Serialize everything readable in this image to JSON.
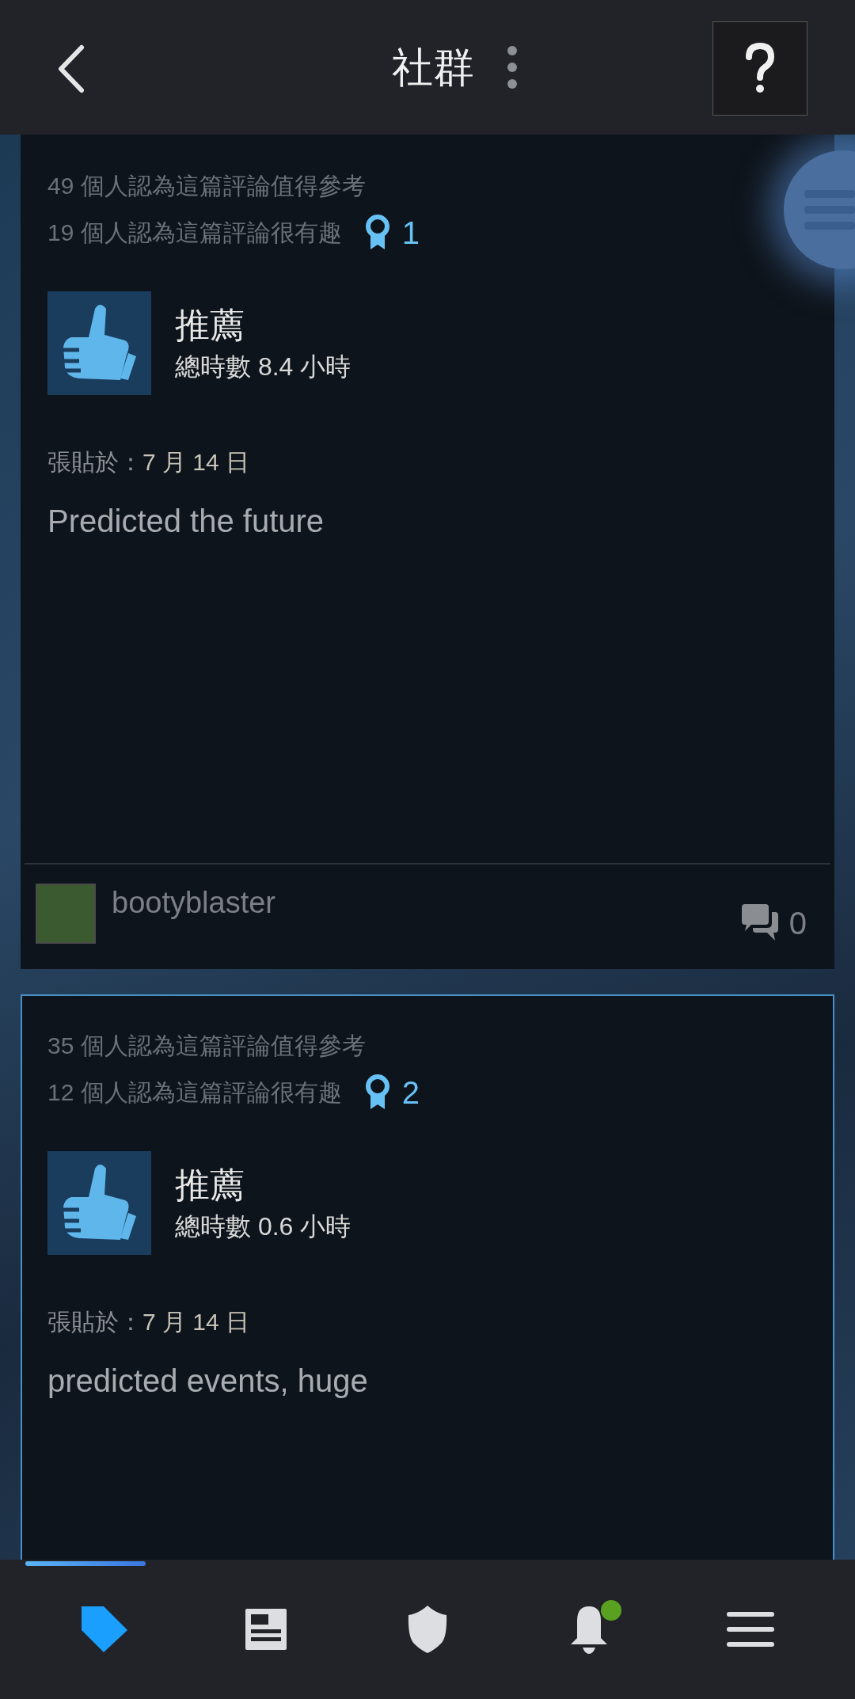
{
  "header": {
    "title": "社群"
  },
  "reviews": [
    {
      "helpful": "49 個人認為這篇評論值得參考",
      "funny": "19 個人認為這篇評論很有趣",
      "awards": "1",
      "verdict": "推薦",
      "playtime": "總時數 8.4 小時",
      "posted_label": "張貼於：",
      "posted_date": "7 月 14 日",
      "text": "Predicted the future",
      "author": "bootyblaster",
      "comments": "0",
      "selected": false
    },
    {
      "helpful": "35 個人認為這篇評論值得參考",
      "funny": "12 個人認為這篇評論很有趣",
      "awards": "2",
      "verdict": "推薦",
      "playtime": "總時數 0.6 小時",
      "posted_label": "張貼於：",
      "posted_date": "7 月 14 日",
      "text": "predicted events, huge",
      "selected": true
    }
  ],
  "nav": [
    {
      "kind": "tag",
      "selected": true,
      "badge": false
    },
    {
      "kind": "news",
      "selected": false,
      "badge": false
    },
    {
      "kind": "shield",
      "selected": false,
      "badge": false
    },
    {
      "kind": "bell",
      "selected": false,
      "badge": true
    },
    {
      "kind": "menu",
      "selected": false,
      "badge": false
    }
  ]
}
